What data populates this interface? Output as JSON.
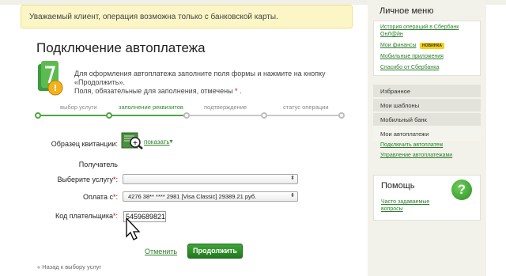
{
  "alert": {
    "text": "Уважаемый клиент, операция возможна только с банковской карты."
  },
  "page": {
    "title": "Подключение автоплатежа",
    "intro_line1": "Для оформления автоплатежа заполните поля формы и нажмите на кнопку",
    "intro_line2": "«Продолжить».",
    "intro_line3": "Поля, обязательные для заполнения, отмечены",
    "required_mark": "*"
  },
  "steps": [
    {
      "label": "выбор услуги",
      "state": "done"
    },
    {
      "label": "заполнение реквизитов",
      "state": "active"
    },
    {
      "label": "подтверждение",
      "state": "pending"
    },
    {
      "label": "статус операции",
      "state": "pending"
    }
  ],
  "form": {
    "receipt_label": "Образец квитанции:",
    "show_link": "показать",
    "recipient_label": "Получатель",
    "service_label": "Выберите услугу",
    "service_value": "",
    "payment_label": "Оплата с",
    "payment_value": "4276 38** **** 2981 [Visa Classic] 29389.21 руб.",
    "payer_code_label": "Код плательщика",
    "payer_code_value": "5459689821",
    "required_mark": "*",
    "colon": ":"
  },
  "actions": {
    "cancel": "Отменить",
    "continue": "Продолжить",
    "back": "« Назад к выбору услуг"
  },
  "sidebar": {
    "personal_menu_title": "Личное меню",
    "personal_links": [
      "История операций в Сбербанк",
      "ОнЛ@йн",
      "Мои финансы",
      "Мобильные приложения",
      "Спасибо от Сбербанка"
    ],
    "new_badge": "НОВИНКА",
    "nav_items": [
      "Избранное",
      "Мои шаблоны",
      "Мобильный банк",
      "Мои автоплатежи"
    ],
    "autopay_links": [
      "Подключить автоплатеж",
      "Управление автоплатежами"
    ],
    "help_title": "Помощь",
    "help_link_line1": "Часто задаваемые",
    "help_link_line2": "вопросы",
    "help_icon_glyph": "?"
  },
  "colors": {
    "accent_green": "#2e8b35",
    "alert_bg": "#fcf6c7",
    "required_red": "#dd0000"
  }
}
